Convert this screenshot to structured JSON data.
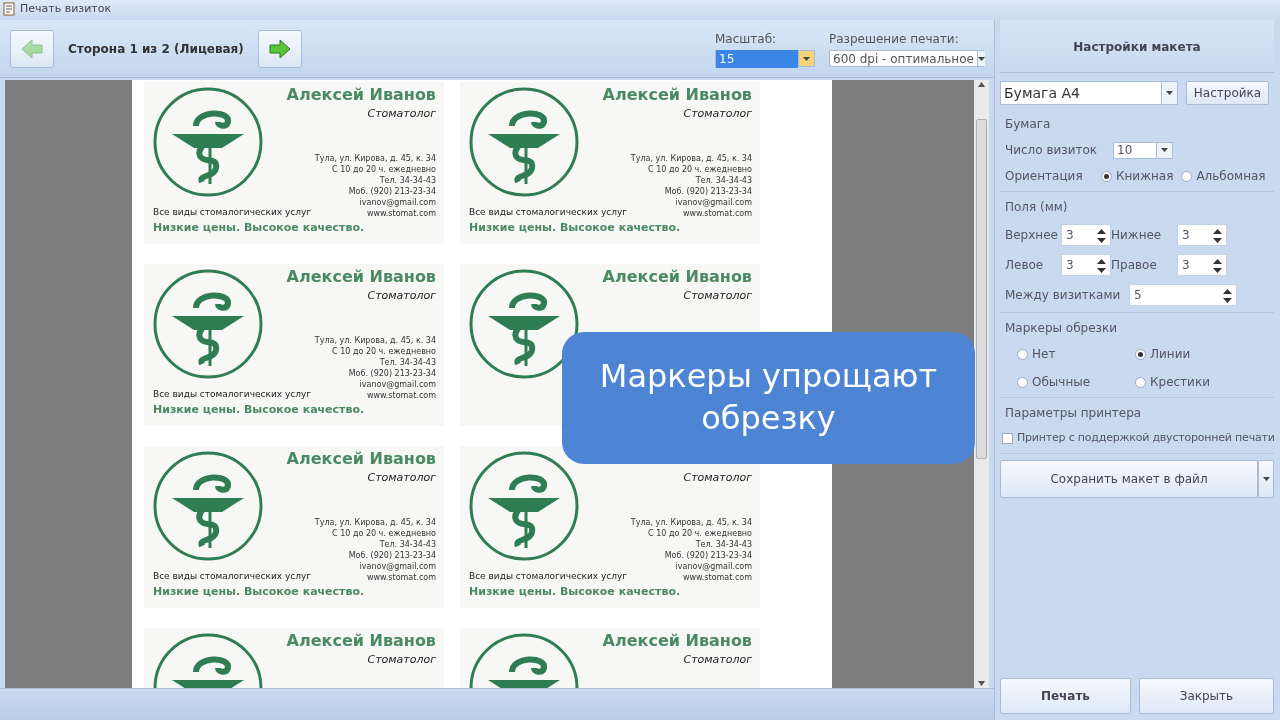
{
  "window": {
    "title": "Печать визиток"
  },
  "toolbar": {
    "prev_button": {
      "disabled": true
    },
    "page_label": "Сторона 1 из 2 (Лицевая)",
    "next_button": {
      "disabled": false
    },
    "zoom": {
      "label": "Масштаб:",
      "value": "15"
    },
    "resolution": {
      "label": "Разрешение печати:",
      "value": "600 dpi - оптимальное"
    }
  },
  "cards": [
    {
      "name": "Алексей Иванов",
      "title": "Стоматолог",
      "contacts": [
        "Тула, ул. Кирова, д. 45, к. 34",
        "С 10 до 20 ч. ежедневно",
        "Тел. 34-34-43",
        "Моб. (920) 213-23-34",
        "ivanov@gmail.com",
        "www.stomat.com"
      ],
      "tagline": "Все виды стомалогических услуг",
      "slogan": "Низкие цены. Высокое качество."
    },
    {
      "name": "Алексей Иванов",
      "title": "Стоматолог",
      "contacts": [
        "Тула, ул. Кирова, д. 45, к. 34",
        "С 10 до 20 ч. ежедневно",
        "Тел. 34-34-43",
        "Моб. (920) 213-23-34",
        "ivanov@gmail.com",
        "www.stomat.com"
      ],
      "tagline": "Все виды стомалогических услуг",
      "slogan": "Низкие цены. Высокое качество."
    },
    {
      "name": "Алексей Иванов",
      "title": "Стоматолог",
      "contacts": [
        "Тула, ул. Кирова, д. 45, к. 34",
        "С 10 до 20 ч. ежедневно",
        "Тел. 34-34-43",
        "Моб. (920) 213-23-34",
        "ivanov@gmail.com",
        "www.stomat.com"
      ],
      "tagline": "Все виды стомалогических услуг",
      "slogan": "Низкие цены. Высокое качество."
    },
    {
      "name": "Алексей Иванов",
      "title": "Стоматолог"
    },
    {
      "name": "Алексей Иванов",
      "title": "Стоматолог",
      "contacts": [
        "Тула, ул. Кирова, д. 45, к. 34",
        "С 10 до 20 ч. ежедневно",
        "Тел. 34-34-43",
        "Моб. (920) 213-23-34",
        "ivanov@gmail.com",
        "www.stomat.com"
      ],
      "tagline": "Все виды стомалогических услуг",
      "slogan": "Низкие цены. Высокое качество."
    },
    {
      "title": "Стоматолог",
      "contacts": [
        "Тула, ул. Кирова, д. 45, к. 34",
        "С 10 до 20 ч. ежедневно",
        "Тел. 34-34-43",
        "Моб. (920) 213-23-34",
        "ivanov@gmail.com",
        "www.stomat.com"
      ],
      "tagline": "Все виды стомалогических услуг",
      "slogan": "Низкие цены. Высокое качество."
    },
    {
      "name": "Алексей Иванов",
      "title": "Стоматолог"
    },
    {
      "name": "Алексей Иванов",
      "title": "Стоматолог"
    }
  ],
  "callout": "Маркеры упрощают обрезку",
  "panel": {
    "title": "Настройки макета",
    "paper": {
      "value": "Бумага А4",
      "button": "Настройка"
    },
    "paper_group": {
      "title": "Бумага",
      "count_label": "Число визиток",
      "count_value": "10",
      "orientation_label": "Ориентация",
      "orientation": [
        {
          "label": "Книжная",
          "selected": true
        },
        {
          "label": "Альбомная",
          "selected": false
        }
      ]
    },
    "margins": {
      "title": "Поля (мм)",
      "fields": [
        {
          "label": "Верхнее",
          "value": "3"
        },
        {
          "label": "Нижнее",
          "value": "3"
        },
        {
          "label": "Левое",
          "value": "3"
        },
        {
          "label": "Правое",
          "value": "3"
        }
      ],
      "between_label": "Между визитками",
      "between_value": "5"
    },
    "markers": {
      "title": "Маркеры обрезки",
      "options": [
        {
          "label": "Нет",
          "selected": false
        },
        {
          "label": "Линии",
          "selected": true
        },
        {
          "label": "Обычные",
          "selected": false
        },
        {
          "label": "Крестики",
          "selected": false
        }
      ]
    },
    "printer": {
      "title": "Параметры принтера",
      "duplex": {
        "label": "Принтер с поддержкой двусторонней печати",
        "checked": false
      }
    },
    "save_button": "Сохранить макет в файл",
    "print_button": "Печать",
    "close_button": "Закрыть"
  }
}
